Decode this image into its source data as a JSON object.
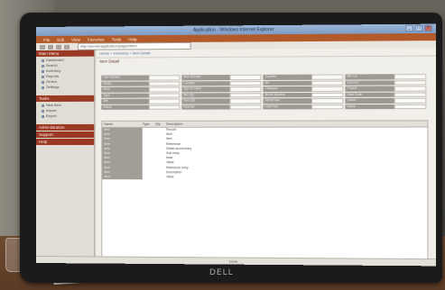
{
  "app": {
    "window_title": "Application - Windows Internet Explorer",
    "brand_logo": "DELL"
  },
  "menu": [
    "File",
    "Edit",
    "View",
    "Favorites",
    "Tools",
    "Help"
  ],
  "address_bar": "http://server/application/pages/item",
  "breadcrumb": "Home > Inventory > Item Detail",
  "section_title": "Item Detail",
  "sidebar": {
    "groups": [
      {
        "heading": "Main Menu",
        "items": [
          "Dashboard",
          "Search",
          "Inventory",
          "Reports",
          "Orders",
          "Settings"
        ]
      },
      {
        "heading": "Tasks",
        "items": [
          "New Item",
          "Import",
          "Export"
        ]
      },
      {
        "heading": "Administration",
        "items": []
      },
      {
        "heading": "Support",
        "items": []
      },
      {
        "heading": "Help",
        "items": []
      }
    ]
  },
  "form": {
    "columns": [
      [
        {
          "label": "Part Number",
          "value": ""
        },
        {
          "label": "Name",
          "value": ""
        },
        {
          "label": "Desc",
          "value": ""
        },
        {
          "label": "Type",
          "value": ""
        },
        {
          "label": "Site",
          "value": ""
        },
        {
          "label": "Status",
          "value": ""
        }
      ],
      [
        {
          "label": "Item Number",
          "value": ""
        },
        {
          "label": "Location",
          "value": ""
        },
        {
          "label": "Qty On Hand",
          "value": ""
        },
        {
          "label": "Min Qty",
          "value": ""
        },
        {
          "label": "Max Qty",
          "value": ""
        },
        {
          "label": "Reorder",
          "value": ""
        }
      ],
      [
        {
          "label": "Supplier",
          "value": ""
        },
        {
          "label": "Mfr",
          "value": ""
        },
        {
          "label": "Category",
          "value": ""
        },
        {
          "label": "Model Number",
          "value": ""
        },
        {
          "label": "Serial Num",
          "value": ""
        },
        {
          "label": "Unit Price",
          "value": ""
        }
      ],
      [
        {
          "label": "Bin Loc",
          "value": ""
        },
        {
          "label": "Account",
          "value": ""
        },
        {
          "label": "Project",
          "value": ""
        },
        {
          "label": "Dept Code",
          "value": ""
        },
        {
          "label": "Owner",
          "value": ""
        },
        {
          "label": "Notes",
          "value": ""
        }
      ]
    ]
  },
  "table": {
    "headers": [
      "Name",
      "Type",
      "Qty",
      "Description"
    ],
    "rows": [
      {
        "c1": "Item",
        "c2": "",
        "c3": "",
        "c4": "Record"
      },
      {
        "c1": "Item",
        "c2": "",
        "c3": "",
        "c4": "Item"
      },
      {
        "c1": "Item",
        "c2": "",
        "c3": "",
        "c4": "Item"
      },
      {
        "c1": "Item",
        "c2": "",
        "c3": "",
        "c4": "Reference"
      },
      {
        "c1": "Item",
        "c2": "",
        "c3": "",
        "c4": "Detail record entry"
      },
      {
        "c1": "Item",
        "c2": "",
        "c3": "",
        "c4": "Sub entry"
      },
      {
        "c1": "Item",
        "c2": "",
        "c3": "",
        "c4": "Note"
      },
      {
        "c1": "Item",
        "c2": "",
        "c3": "",
        "c4": "Value"
      },
      {
        "c1": "Item",
        "c2": "",
        "c3": "",
        "c4": "Reference entry"
      },
      {
        "c1": "Item",
        "c2": "",
        "c3": "",
        "c4": "Description"
      },
      {
        "c1": "Item",
        "c2": "",
        "c3": "",
        "c4": "Value"
      }
    ]
  },
  "status_bar": "Done"
}
